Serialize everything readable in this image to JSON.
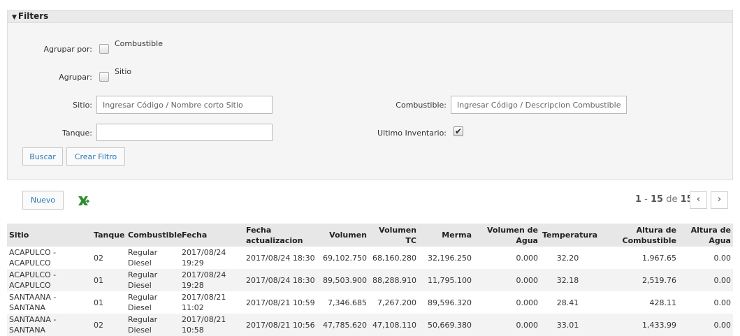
{
  "filters": {
    "title": "Filters",
    "agrupar_por_label": "Agrupar por:",
    "agrupar_por_option": "Combustible",
    "agrupar_label": "Agrupar:",
    "agrupar_option": "Sitio",
    "sitio_label": "Sitio:",
    "sitio_placeholder": "Ingresar Código / Nombre corto Sitio",
    "combustible_label": "Combustible:",
    "combustible_placeholder": "Ingresar Código / Descripcion Combustible",
    "tanque_label": "Tanque:",
    "tanque_value": "",
    "ultimo_label": "Ultimo Inventario:",
    "ultimo_checked": true,
    "buscar_label": "Buscar",
    "crear_filtro_label": "Crear Filtro"
  },
  "toolbar": {
    "nuevo_label": "Nuevo",
    "excel_icon": "excel-export-icon"
  },
  "pager": {
    "from": "1",
    "sep": " - ",
    "to": "15",
    "de": " de ",
    "total": "15",
    "prev": "‹",
    "next": "›"
  },
  "table": {
    "headers": [
      "Sitio",
      "Tanque",
      "Combustible",
      "Fecha",
      "Fecha actualizacion",
      "Volumen",
      "Volumen TC",
      "Merma",
      "Volumen de Agua",
      "Temperatura",
      "Altura de Combustible",
      "Altura de Agua"
    ],
    "rows": [
      [
        "ACAPULCO - ACAPULCO",
        "02",
        "Regular Diesel",
        "2017/08/24 19:29",
        "2017/08/24 18:30",
        "69,102.750",
        "68,160.280",
        "32,196.250",
        "0.000",
        "32.20",
        "1,967.65",
        "0.00"
      ],
      [
        "ACAPULCO - ACAPULCO",
        "01",
        "Regular Diesel",
        "2017/08/24 19:28",
        "2017/08/24 18:30",
        "89,503.900",
        "88,288.910",
        "11,795.100",
        "0.000",
        "32.18",
        "2,519.76",
        "0.00"
      ],
      [
        "SANTAANA - SANTANA",
        "01",
        "Regular Diesel",
        "2017/08/21 11:02",
        "2017/08/21 10:59",
        "7,346.685",
        "7,267.200",
        "89,596.320",
        "0.000",
        "28.41",
        "428.11",
        "0.00"
      ],
      [
        "SANTAANA - SANTANA",
        "02",
        "Regular Diesel",
        "2017/08/21 10:58",
        "2017/08/21 10:56",
        "47,785.620",
        "47,108.110",
        "50,669.380",
        "0.000",
        "33.01",
        "1,433.99",
        "0.00"
      ]
    ]
  }
}
